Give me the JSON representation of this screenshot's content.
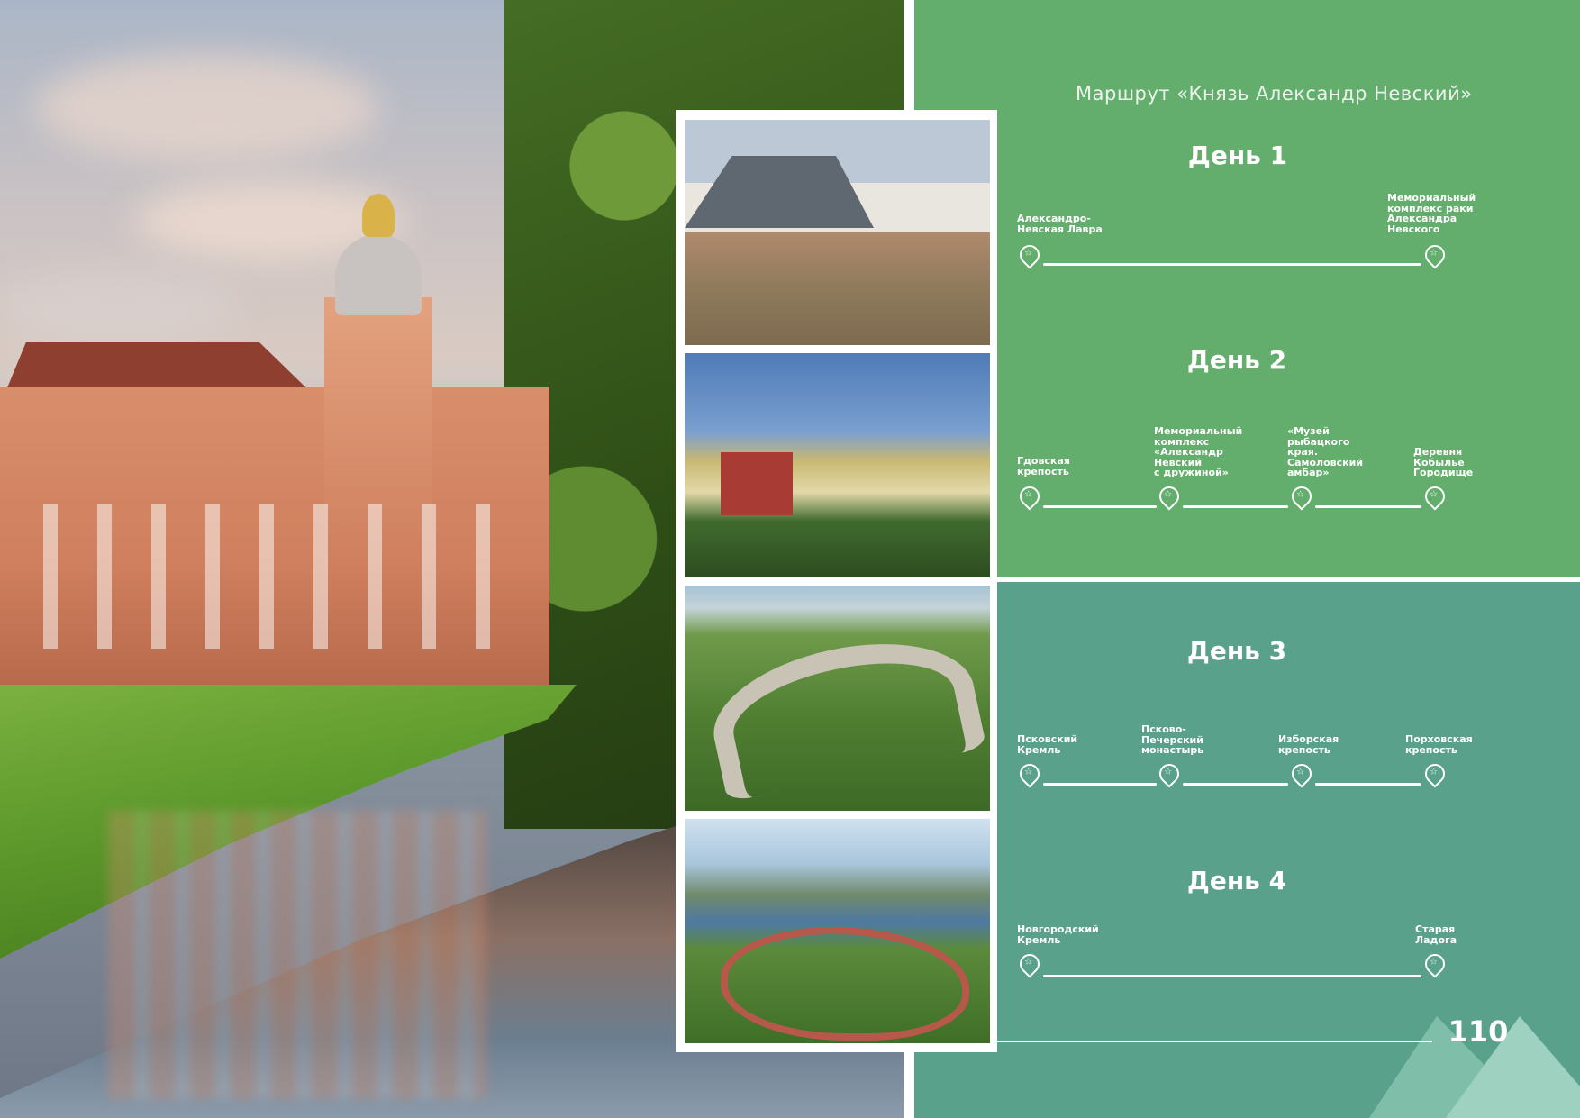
{
  "route_title": "Маршрут «Князь Александр Невский»",
  "page_number": "110",
  "colors": {
    "panel_top": "#63ae6d",
    "panel_bottom": "#5aa18c",
    "triangle_light": "#9fd1c1",
    "triangle_mid": "#7fbfaa"
  },
  "photos": [
    {
      "name": "manor-house-photo"
    },
    {
      "name": "pskovo-pechersky-monastery-photo"
    },
    {
      "name": "izborsk-fortress-photo"
    },
    {
      "name": "novgorod-kremlin-aerial-photo"
    }
  ],
  "days": [
    {
      "title": "День 1",
      "stops": [
        "Александро-\nНевская Лавра",
        "Мемориальный\nкомплекс раки\nАлександра\nНевского"
      ]
    },
    {
      "title": "День 2",
      "stops": [
        "Гдовская\nкрепость",
        "Мемориальный\nкомплекс\n«Александр\nНевский\nс дружиной»",
        "«Музей\nрыбацкого\nкрая.\nСамоловский\nамбар»",
        "Деревня\nКобылье\nГородище"
      ]
    },
    {
      "title": "День 3",
      "stops": [
        "Псковский\nКремль",
        "Псково-\nПечерский\nмонастырь",
        "Изборская\nкрепость",
        "Порховская\nкрепость"
      ]
    },
    {
      "title": "День 4",
      "stops": [
        "Новгородский\nКремль",
        "Старая\nЛадога"
      ]
    }
  ]
}
